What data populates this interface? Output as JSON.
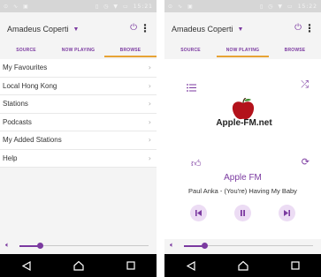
{
  "accent_color": "#7b3aa0",
  "tab_underline_color": "#e7a335",
  "status_bar": {
    "time_left": "15:21",
    "time_right": "15:22"
  },
  "app": {
    "zone_name": "Amadeus Coperti"
  },
  "tabs": [
    "SOURCE",
    "NOW PLAYING",
    "BROWSE"
  ],
  "left_screen": {
    "active_tab_index": 2
  },
  "right_screen": {
    "active_tab_index": 1
  },
  "browse": {
    "items": [
      {
        "label": "My Favourites"
      },
      {
        "label": "Local Hong Kong"
      },
      {
        "label": "Stations"
      },
      {
        "label": "Podcasts"
      },
      {
        "label": "My Added Stations"
      },
      {
        "label": "Help"
      }
    ]
  },
  "now_playing": {
    "station_logo_text": "Apple-FM.net",
    "station_name": "Apple FM",
    "track": "Paul Anka - (You're) Having My Baby"
  },
  "volume_left": {
    "level_fraction": 0.16
  },
  "volume_right": {
    "level_fraction": 0.16
  },
  "icons": {
    "power": "power-icon",
    "menu": "more-vert-icon",
    "volume": "speaker-icon",
    "queue": "list-icon",
    "shuffle": "shuffle-icon",
    "thumb": "thumb-up-icon",
    "repeat": "repeat-icon",
    "prev": "skip-previous-icon",
    "pause": "pause-icon",
    "next": "skip-next-icon",
    "back": "back-icon",
    "home": "home-icon",
    "recents": "recents-icon"
  }
}
